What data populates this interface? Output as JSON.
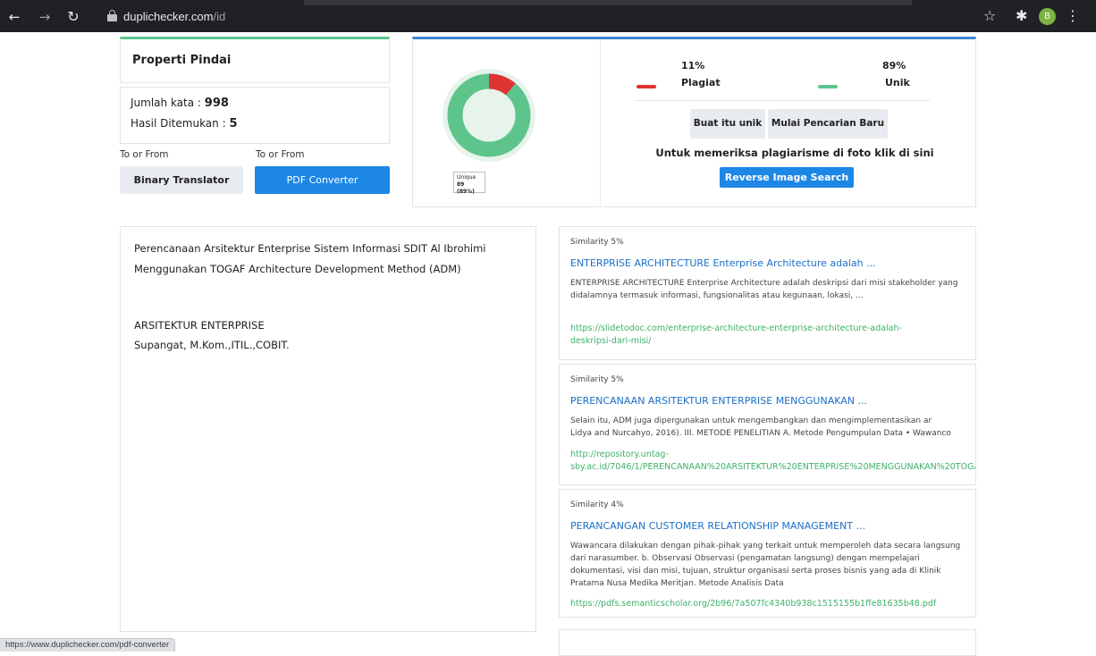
{
  "browser": {
    "url_domain": "duplichecker.com",
    "url_path": "/id",
    "profile_initial": "B",
    "status_url": "https://www.duplichecker.com/pdf-converter"
  },
  "scan": {
    "title": "Properti Pindai",
    "word_count_label": "Jumlah kata :",
    "word_count": "998",
    "found_label": "Hasil Ditemukan :",
    "found": "5"
  },
  "tools": {
    "to_from_1": "To or From",
    "to_from_2": "To or From",
    "binary_label": "Binary Translator",
    "pdf_label": "PDF Converter"
  },
  "results": {
    "plagiat_pct": "11%",
    "unik_pct": "89%",
    "plagiat_label": "Plagiat",
    "unik_label": "Unik",
    "buat_unik": "Buat itu unik",
    "mulai_baru": "Mulai Pencarian Baru",
    "photo_check": "Untuk memeriksa plagiarisme di foto klik di sini",
    "reverse_image": "Reverse Image Search",
    "tooltip_label": "Unique",
    "tooltip_value": "89 (89%)",
    "plagiat_fraction": 0.11,
    "colors": {
      "plagiat": "#e03434",
      "unik": "#5dc48c",
      "accent_blue": "#1d87e6"
    }
  },
  "document": {
    "lines": [
      "Perencanaan Arsitektur Enterprise Sistem Informasi SDIT Al Ibrohimi",
      "Menggunakan TOGAF Architecture Development Method (ADM)",
      "ARSITEKTUR ENTERPRISE",
      "Supangat, M.Kom.,ITIL.,COBIT."
    ]
  },
  "matches": [
    {
      "similarity": "Similarity 5%",
      "title": "ENTERPRISE ARCHITECTURE Enterprise Architecture adalah ...",
      "desc": "ENTERPRISE ARCHITECTURE Enterprise Architecture adalah deskripsi dari misi stakeholder yang didalamnya termasuk informasi, fungsionalitas atau kegunaan, lokasi, ...",
      "link_1": "https://slidetodoc.com/enterprise-architecture-enterprise-architecture-adalah-",
      "link_2": "deskripsi-dari-misi/"
    },
    {
      "similarity": "Similarity 5%",
      "title": "PERENCANAAN ARSITEKTUR ENTERPRISE MENGGUNAKAN ...",
      "desc_1": "Selain itu, ADM juga dipergunakan untuk mengembangkan dan mengimplementasikan ar",
      "desc_2": "Lidya and Nurcahyo, 2016). III. METODE PENELITIAN A. Metode Pengumpulan Data • Wawanco",
      "link_1": "http://repository.untag-",
      "link_2": "sby.ac.id/7046/1/PERENCANAAN%20ARSITEKTUR%20ENTERPRISE%20MENGGUNAKAN%20TOGA"
    },
    {
      "similarity": "Similarity 4%",
      "title": "PERANCANGAN CUSTOMER RELATIONSHIP MANAGEMENT ...",
      "desc": "Wawancara dilakukan dengan pihak-pihak yang terkait untuk memperoleh data secara langsung dari narasumber. b. Observasi Observasi (pengamatan langsung) dengan mempelajari dokumentasi, visi dan misi, tujuan, struktur organisasi serta proses bisnis yang ada di Klinik Pratama Nusa Medika Meritjan. Metode Analisis Data",
      "link_1": "https://pdfs.semanticscholar.org/2b96/7a507fc4340b938c1515155b1ffe81635b48.pdf"
    }
  ]
}
